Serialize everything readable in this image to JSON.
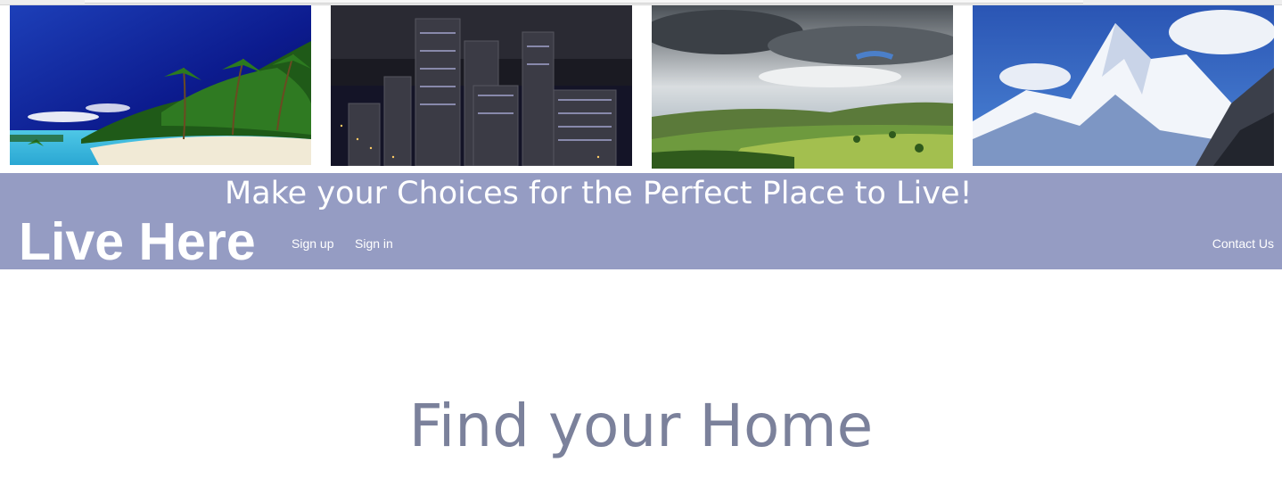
{
  "gallery": {
    "images": [
      {
        "subject": "tropical-beach-photo"
      },
      {
        "subject": "night-city-skyline-photo"
      },
      {
        "subject": "cloudy-green-valley-photo"
      },
      {
        "subject": "snowy-mountain-photo"
      }
    ]
  },
  "header": {
    "tagline": "Make your Choices for the Perfect Place to Live!",
    "brand": "Live Here",
    "nav": {
      "signup": "Sign up",
      "signin": "Sign in",
      "contact": "Contact Us"
    }
  },
  "main": {
    "heading": "Find your Home"
  },
  "colors": {
    "banner": "#959cc3",
    "heading": "#7b819b",
    "banner_text": "#ffffff"
  }
}
